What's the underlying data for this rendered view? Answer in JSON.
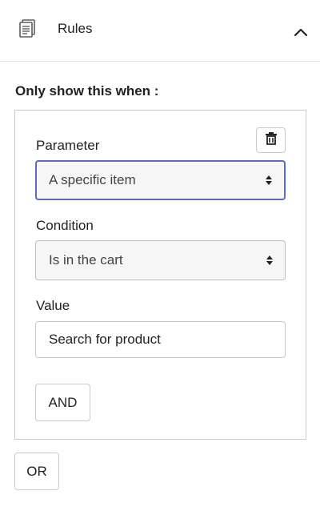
{
  "header": {
    "title": "Rules",
    "icon": "document-icon",
    "toggle_icon": "chevron-up-icon"
  },
  "rules": {
    "heading": "Only show this when :",
    "delete_icon": "trash-icon",
    "parameter": {
      "label": "Parameter",
      "value": "A specific item"
    },
    "condition": {
      "label": "Condition",
      "value": "Is in the cart"
    },
    "value": {
      "label": "Value",
      "text": "Search for product"
    },
    "and_label": "AND",
    "or_label": "OR"
  },
  "colors": {
    "focus_border": "#5c6ac4",
    "border": "#c9cccf",
    "text": "#202223"
  }
}
